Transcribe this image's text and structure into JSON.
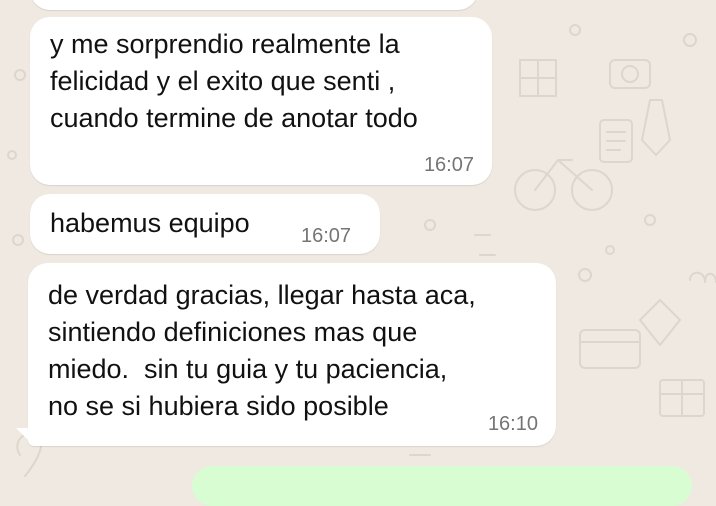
{
  "messages": [
    {
      "lines": [
        ""
      ],
      "time": ""
    },
    {
      "lines": [
        "y me sorprendio realmente la",
        "felicidad y el exito que senti ,",
        "cuando termine de anotar todo"
      ],
      "time": "16:07"
    },
    {
      "lines": [
        "habemus equipo"
      ],
      "time": "16:07"
    },
    {
      "lines": [
        "de verdad gracias, llegar hasta aca,",
        "sintiendo definiciones mas que",
        "miedo.  sin tu guia y tu paciencia,",
        "no se si hubiera sido posible"
      ],
      "time": "16:10"
    }
  ],
  "colors": {
    "wallpaper": "#efe9e1",
    "incoming_bubble": "#ffffff",
    "outgoing_bubble": "#d8fdd2",
    "timestamp": "#757575"
  },
  "icons": [
    "doodle-wallpaper-icons"
  ]
}
